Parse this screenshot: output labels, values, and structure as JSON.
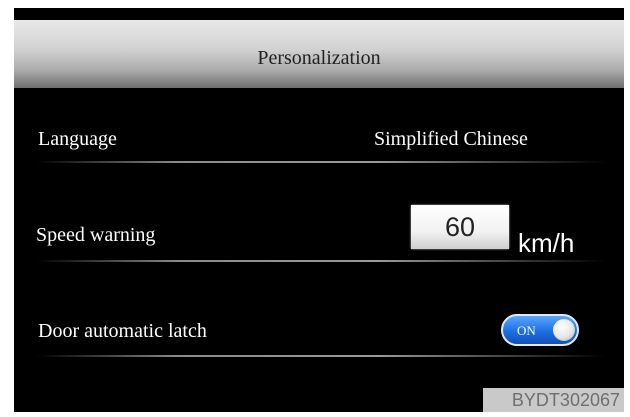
{
  "header": {
    "title": "Personalization"
  },
  "settings": {
    "language": {
      "label": "Language",
      "value": "Simplified Chinese"
    },
    "speed_warning": {
      "label": "Speed warning",
      "value": "60",
      "unit": "km/h"
    },
    "door_latch": {
      "label": "Door automatic latch",
      "toggle_text": "ON",
      "state": "on"
    }
  },
  "watermark": {
    "text": "BYDT302067"
  },
  "colors": {
    "screen_background": "#000000",
    "toggle_on": "#1e6fe0"
  }
}
